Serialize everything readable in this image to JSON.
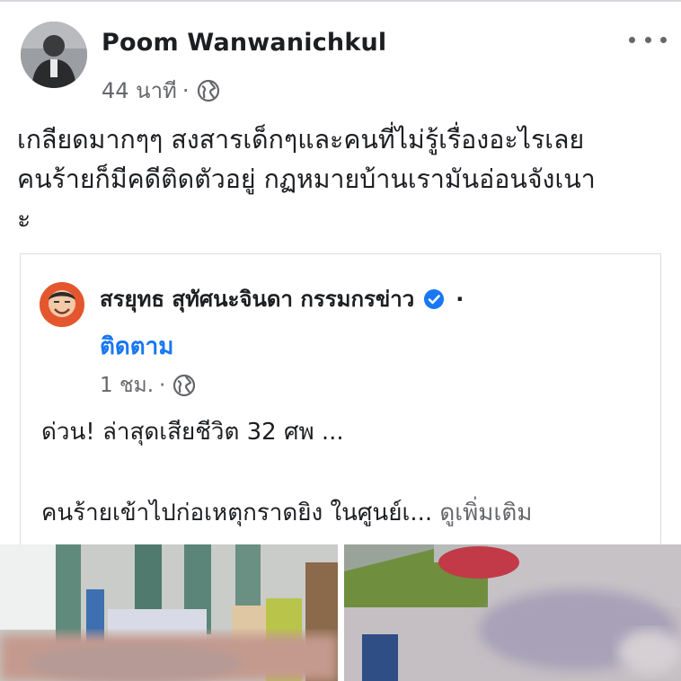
{
  "post": {
    "author": "Poom Wanwanichkul",
    "time": "44 นาที",
    "separator": "·",
    "privacy_icon": "globe-icon",
    "more_icon": "more-options-icon",
    "text_lines": [
      "เกลียดมากๆๆ สงสารเด็กๆและคนที่ไม่รู้เรื่องอะไรเลย",
      "คนร้ายก็มีคดีติดตัวอยู่ กฏหมายบ้านเรามันอ่อนจังเนา",
      "ะ"
    ]
  },
  "shared": {
    "author": "สรยุทธ สุทัศนะจินดา กรรมกรข่าว",
    "verified_icon": "verified-badge-icon",
    "separator": "·",
    "follow": "ติดตาม",
    "time": "1 ชม.",
    "privacy_icon": "globe-icon",
    "line1": "ด่วน! ล่าสุดเสียชีวิต 32 ศพ ...",
    "line2": "คนร้ายเข้าไปก่อเหตุกราดยิง ในศูนย์เ...",
    "see_more": "ดูเพิ่มเติม"
  },
  "colors": {
    "link_blue": "#1877f2",
    "secondary_text": "#65676b",
    "primary_text": "#1c1e21",
    "border": "#dadde1"
  }
}
